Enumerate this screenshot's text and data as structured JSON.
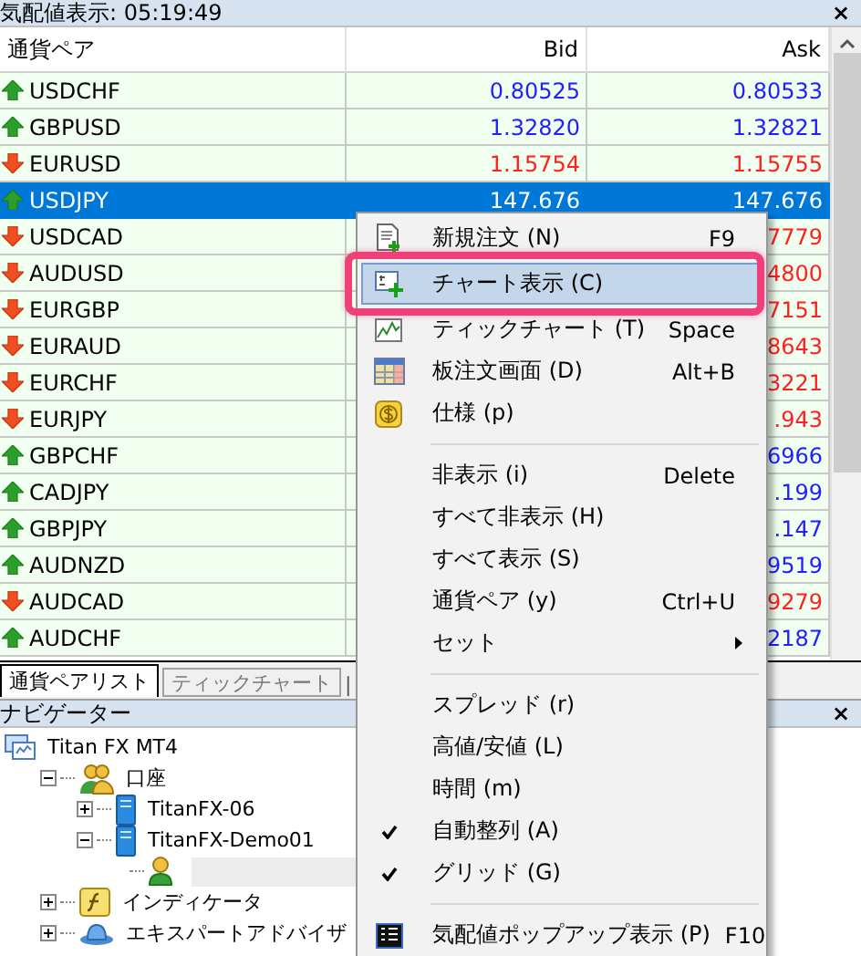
{
  "market_watch": {
    "title": "気配値表示: 05:19:49",
    "close": "×",
    "columns": [
      "通貨ペア",
      "Bid",
      "Ask"
    ],
    "rows": [
      {
        "pair": "USDCHF",
        "rising": true,
        "bid": "0.80525",
        "ask": "0.80533",
        "selected": false
      },
      {
        "pair": "GBPUSD",
        "rising": true,
        "bid": "1.32820",
        "ask": "1.32821",
        "selected": false
      },
      {
        "pair": "EURUSD",
        "rising": false,
        "bid": "1.15754",
        "ask": "1.15755",
        "selected": false
      },
      {
        "pair": "USDJPY",
        "rising": true,
        "bid": "147.676",
        "ask": "147.676",
        "selected": true
      },
      {
        "pair": "USDCAD",
        "rising": false,
        "ask": "7779",
        "selected": false
      },
      {
        "pair": "AUDUSD",
        "rising": false,
        "ask": "4800",
        "selected": false
      },
      {
        "pair": "EURGBP",
        "rising": false,
        "ask": "7151",
        "selected": false
      },
      {
        "pair": "EURAUD",
        "rising": false,
        "ask": "8643",
        "selected": false
      },
      {
        "pair": "EURCHF",
        "rising": false,
        "ask": "3221",
        "selected": false
      },
      {
        "pair": "EURJPY",
        "rising": false,
        "ask": ".943",
        "selected": false
      },
      {
        "pair": "GBPCHF",
        "rising": true,
        "ask": "6966",
        "selected": false
      },
      {
        "pair": "CADJPY",
        "rising": true,
        "ask": ".199",
        "selected": false
      },
      {
        "pair": "GBPJPY",
        "rising": true,
        "ask": ".147",
        "selected": false
      },
      {
        "pair": "AUDNZD",
        "rising": true,
        "ask": "9519",
        "selected": false
      },
      {
        "pair": "AUDCAD",
        "rising": false,
        "ask": "9279",
        "selected": false
      },
      {
        "pair": "AUDCHF",
        "rising": true,
        "ask": "2187",
        "selected": false
      }
    ],
    "tabs": [
      {
        "label": "通貨ペアリスト",
        "selected": true
      },
      {
        "label": "ティックチャート",
        "selected": false
      }
    ],
    "tab_divider": "|"
  },
  "navigator": {
    "title": "ナビゲーター",
    "close": "×",
    "tree": [
      {
        "kind": "terminal",
        "label": "Titan FX MT4",
        "children": [
          {
            "kind": "accounts",
            "label": "口座",
            "expanded": true,
            "children": [
              {
                "kind": "server",
                "label": "TitanFX-06",
                "expanded": false
              },
              {
                "kind": "server",
                "label": "TitanFX-Demo01",
                "expanded": true,
                "children": [
                  {
                    "kind": "account"
                  }
                ]
              }
            ]
          },
          {
            "kind": "indicators",
            "label": "インディケータ",
            "expanded": false
          },
          {
            "kind": "experts",
            "label": "エキスパートアドバイザ",
            "expanded": false
          }
        ]
      }
    ]
  },
  "context_menu": {
    "items": [
      {
        "kind": "item",
        "label": "新規注文 (N)",
        "shortcut": "F9",
        "selected": false,
        "checked": false
      },
      {
        "kind": "item",
        "label": "チャート表示 (C)",
        "selected": true,
        "checked": false
      },
      {
        "kind": "item",
        "label": "ティックチャート (T)",
        "shortcut": "Space",
        "selected": false,
        "checked": false
      },
      {
        "kind": "item",
        "label": "板注文画面 (D)",
        "shortcut": "Alt+B",
        "selected": false,
        "checked": false
      },
      {
        "kind": "item",
        "label": "仕様 (p)",
        "selected": false,
        "checked": false
      },
      {
        "kind": "separator"
      },
      {
        "kind": "item",
        "label": "非表示 (i)",
        "shortcut": "Delete",
        "selected": false,
        "checked": false
      },
      {
        "kind": "item",
        "label": "すべて非表示 (H)",
        "selected": false,
        "checked": false
      },
      {
        "kind": "item",
        "label": "すべて表示 (S)",
        "selected": false,
        "checked": false
      },
      {
        "kind": "item",
        "label": "通貨ペア (y)",
        "shortcut": "Ctrl+U",
        "selected": false,
        "checked": false
      },
      {
        "kind": "submenu",
        "label": "セット",
        "selected": false,
        "checked": false
      },
      {
        "kind": "separator"
      },
      {
        "kind": "item",
        "label": "スプレッド (r)",
        "selected": false,
        "checked": false
      },
      {
        "kind": "item",
        "label": "高値/安値 (L)",
        "selected": false,
        "checked": false
      },
      {
        "kind": "item",
        "label": "時間 (m)",
        "selected": false,
        "checked": false
      },
      {
        "kind": "item",
        "label": "自動整列 (A)",
        "selected": false,
        "checked": true
      },
      {
        "kind": "item",
        "label": "グリッド (G)",
        "selected": false,
        "checked": true
      },
      {
        "kind": "separator"
      },
      {
        "kind": "item",
        "label": "気配値ポップアップ表示 (P)",
        "shortcut": "F10",
        "selected": false,
        "checked": false
      }
    ]
  }
}
